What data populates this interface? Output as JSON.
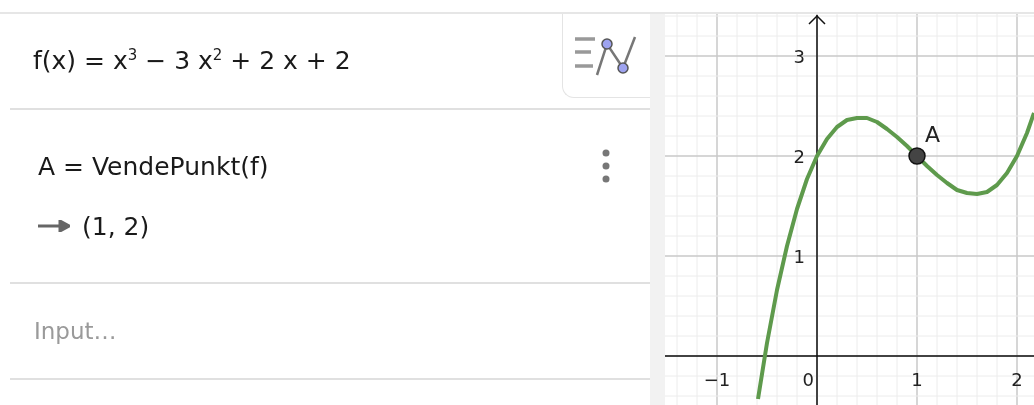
{
  "algebra": {
    "rows": [
      {
        "kind": "function",
        "formula": "f(x) = x$^{3}$ − 3 x$^{2}$ + 2 x + 2"
      },
      {
        "kind": "command",
        "definition": "A = VendePunkt(f)",
        "result": "(1, 2)"
      }
    ],
    "input": {
      "placeholder": "Input…"
    }
  },
  "graph": {
    "chart_data": {
      "type": "line",
      "xlim": [
        -1.52,
        2.17
      ],
      "ylim": [
        -0.49,
        3.42
      ],
      "xticks": [
        -1,
        0,
        1,
        2
      ],
      "yticks": [
        1,
        2,
        3
      ],
      "grid": true,
      "x": [
        -0.59,
        -0.5,
        -0.4,
        -0.3,
        -0.2,
        -0.1,
        0,
        0.1,
        0.2,
        0.3,
        0.4,
        0.5,
        0.6,
        0.7,
        0.8,
        0.9,
        1,
        1.1,
        1.2,
        1.3,
        1.4,
        1.5,
        1.6,
        1.7,
        1.8,
        1.9,
        2,
        2.1,
        2.17
      ],
      "series": [
        {
          "color": "#5e9a4c",
          "values": [
            -0.43,
            0.13,
            0.66,
            1.1,
            1.47,
            1.77,
            2,
            2.17,
            2.29,
            2.36,
            2.38,
            2.38,
            2.34,
            2.27,
            2.19,
            2.1,
            2,
            1.9,
            1.81,
            1.73,
            1.66,
            1.63,
            1.62,
            1.64,
            1.71,
            1.83,
            2,
            2.23,
            2.43
          ]
        }
      ],
      "annotations": [
        {
          "x": 1,
          "y": 2,
          "text": "A"
        }
      ]
    }
  }
}
